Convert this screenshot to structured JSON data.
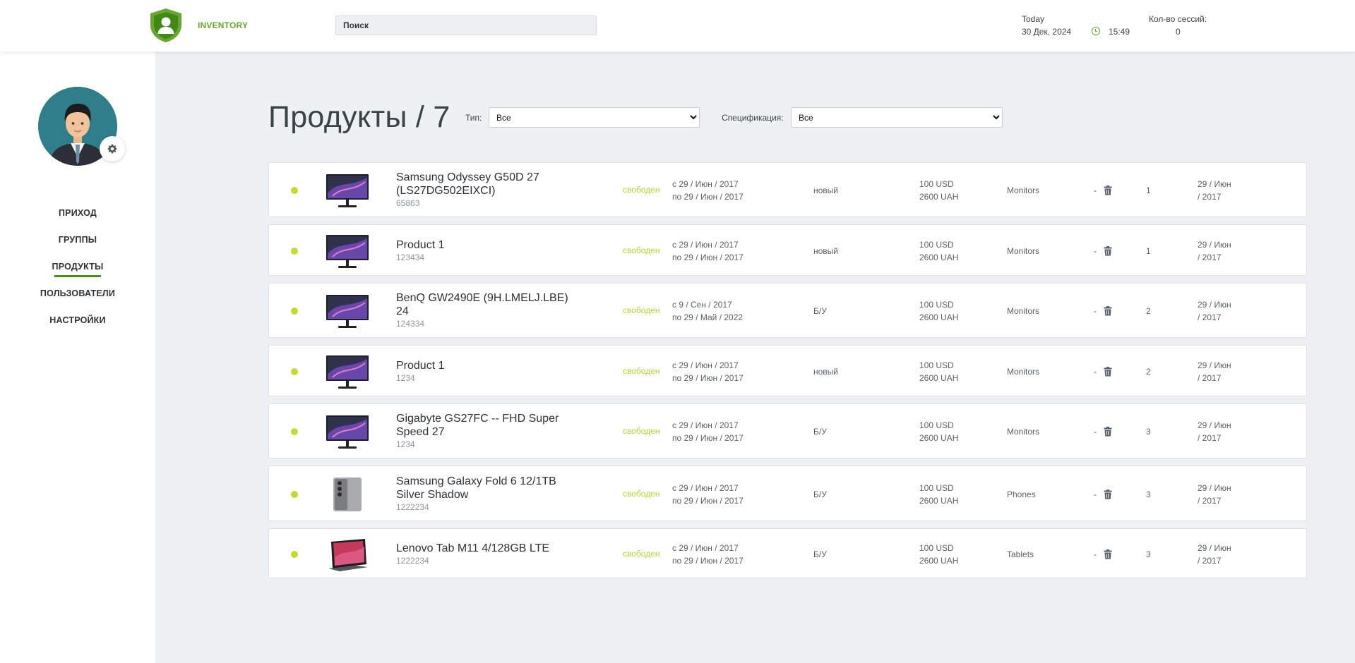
{
  "header": {
    "logo_text": "INVENTORY",
    "search_placeholder": "Поиск",
    "today_label": "Today",
    "date": "30 Дек, 2024",
    "time": "15:49",
    "sessions_label": "Кол-во сессий:",
    "sessions_count": "0",
    "accent_color": "#6aa531"
  },
  "sidebar": {
    "nav": [
      {
        "label": "ПРИХОД",
        "active": false
      },
      {
        "label": "ГРУППЫ",
        "active": false
      },
      {
        "label": "ПРОДУКТЫ",
        "active": true
      },
      {
        "label": "ПОЛЬЗОВАТЕЛИ",
        "active": false
      },
      {
        "label": "НАСТРОЙКИ",
        "active": false
      }
    ]
  },
  "main": {
    "title": "Продукты / 7",
    "type_label": "Тип:",
    "type_value": "Все",
    "spec_label": "Спецификация:",
    "spec_value": "Все"
  },
  "products": [
    {
      "name": "Samsung Odyssey G50D 27 (LS27DG502EIXCI)",
      "code": "65863",
      "status": "свободен",
      "from": "с 29 / Июн / 2017",
      "to": "по 29 / Июн / 2017",
      "condition": "новый",
      "price_usd": "100 USD",
      "price_uah": "2600 UAH",
      "type": "Monitors",
      "dash": "-",
      "count": "1",
      "date_1": "29 / Июн",
      "date_2": "/ 2017",
      "image": "monitor-icon"
    },
    {
      "name": "Product 1",
      "code": "123434",
      "status": "свободен",
      "from": "с 29 / Июн / 2017",
      "to": "по 29 / Июн / 2017",
      "condition": "новый",
      "price_usd": "100 USD",
      "price_uah": "2600 UAH",
      "type": "Monitors",
      "dash": "-",
      "count": "1",
      "date_1": "29 / Июн",
      "date_2": "/ 2017",
      "image": "monitor-icon"
    },
    {
      "name": "BenQ GW2490E (9H.LMELJ.LBE) 24",
      "code": "124334",
      "status": "свободен",
      "from": "с 9 / Сен / 2017",
      "to": "по 29 / Май / 2022",
      "condition": "Б/У",
      "price_usd": "100 USD",
      "price_uah": "2600 UAH",
      "type": "Monitors",
      "dash": "-",
      "count": "2",
      "date_1": "29 / Июн",
      "date_2": "/ 2017",
      "image": "monitor-icon"
    },
    {
      "name": "Product 1",
      "code": "1234",
      "status": "свободен",
      "from": "с 29 / Июн / 2017",
      "to": "по 29 / Июн / 2017",
      "condition": "новый",
      "price_usd": "100 USD",
      "price_uah": "2600 UAH",
      "type": "Monitors",
      "dash": "-",
      "count": "2",
      "date_1": "29 / Июн",
      "date_2": "/ 2017",
      "image": "monitor-icon"
    },
    {
      "name": "Gigabyte GS27FC -- FHD Super Speed 27",
      "code": "1234",
      "status": "свободен",
      "from": "с 29 / Июн / 2017",
      "to": "по 29 / Июн / 2017",
      "condition": "Б/У",
      "price_usd": "100 USD",
      "price_uah": "2600 UAH",
      "type": "Monitors",
      "dash": "-",
      "count": "3",
      "date_1": "29 / Июн",
      "date_2": "/ 2017",
      "image": "monitor-icon"
    },
    {
      "name": "Samsung Galaxy Fold 6 12/1TB Silver Shadow",
      "code": "1222234",
      "status": "свободен",
      "from": "с 29 / Июн / 2017",
      "to": "по 29 / Июн / 2017",
      "condition": "Б/У",
      "price_usd": "100 USD",
      "price_uah": "2600 UAH",
      "type": "Phones",
      "dash": "-",
      "count": "3",
      "date_1": "29 / Июн",
      "date_2": "/ 2017",
      "image": "phone-icon"
    },
    {
      "name": "Lenovo Tab M11 4/128GB LTE",
      "code": "1222234",
      "status": "свободен",
      "from": "с 29 / Июн / 2017",
      "to": "по 29 / Июн / 2017",
      "condition": "Б/У",
      "price_usd": "100 USD",
      "price_uah": "2600 UAH",
      "type": "Tablets",
      "dash": "-",
      "count": "3",
      "date_1": "29 / Июн",
      "date_2": "/ 2017",
      "image": "tablet-icon"
    }
  ]
}
